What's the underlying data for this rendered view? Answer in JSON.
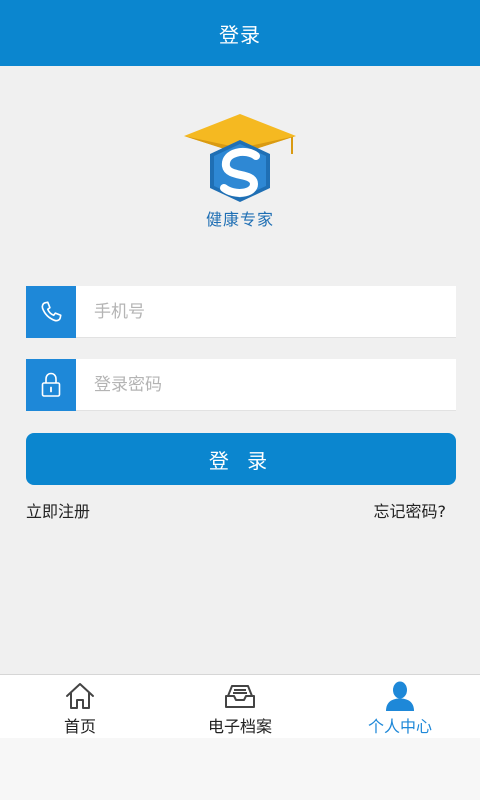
{
  "header": {
    "title": "登录"
  },
  "logo": {
    "brand_text": "健康专家"
  },
  "form": {
    "phone_placeholder": "手机号",
    "password_placeholder": "登录密码",
    "login_label": "登 录",
    "register_label": "立即注册",
    "forgot_label": "忘记密码?"
  },
  "tabbar": {
    "items": [
      {
        "label": "首页",
        "icon": "home-icon",
        "active": false
      },
      {
        "label": "电子档案",
        "icon": "inbox-tray-icon",
        "active": false
      },
      {
        "label": "个人中心",
        "icon": "person-icon",
        "active": true
      }
    ]
  },
  "colors": {
    "primary": "#0b86cf",
    "icon_box": "#1e88d8",
    "logo_gold": "#f5b921",
    "active_tab": "#1e88d8",
    "background": "#f0f0f0"
  }
}
